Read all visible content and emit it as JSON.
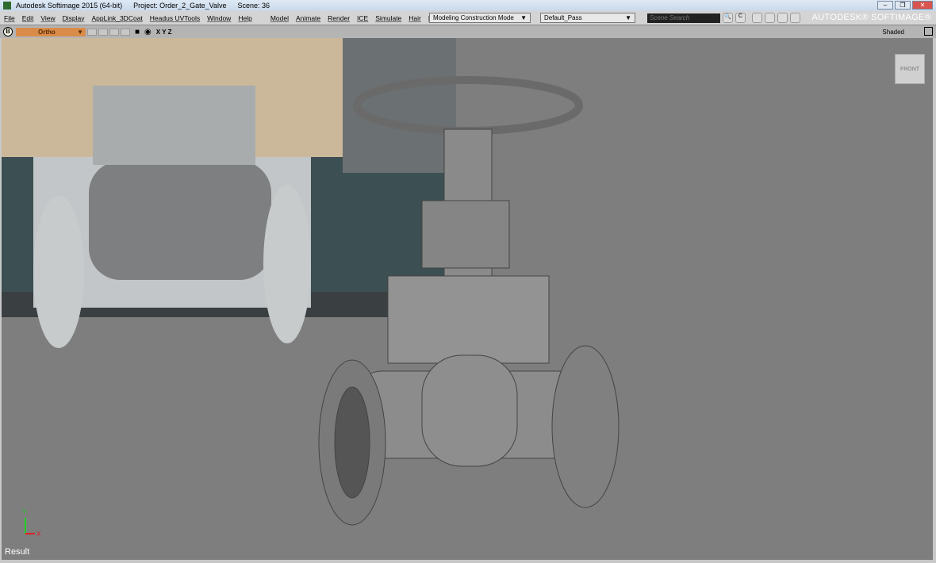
{
  "titlebar": {
    "app": "Autodesk Softimage 2015 (64-bit)",
    "project": "Project: Order_2_Gate_Valve",
    "scene": "Scene: 36",
    "minimize": "–",
    "restore": "❐",
    "close": "✕"
  },
  "menu": [
    "File",
    "Edit",
    "View",
    "Display",
    "AppLink_3DCoat",
    "Headus UVTools",
    "Window",
    "Help",
    "Model",
    "Animate",
    "Render",
    "ICE",
    "Simulate",
    "Hair",
    "Face Robot"
  ],
  "toolbar": {
    "mode": "Modeling Construction Mode",
    "pass": "Default_Pass",
    "search_placeholder": "Scene Search",
    "brand": "AUTODESK® SOFTIMAGE®"
  },
  "viewport": {
    "camera_badge": "B",
    "view": "Ortho",
    "axes": "X Y Z",
    "display_mode": "Shaded",
    "viewcube": "FRONT",
    "status": "Result",
    "axis_x": "X",
    "axis_y": "Y"
  },
  "colors": {
    "viewport_bg": "#7e7e7e",
    "ortho_bar": "#d98c4a"
  }
}
